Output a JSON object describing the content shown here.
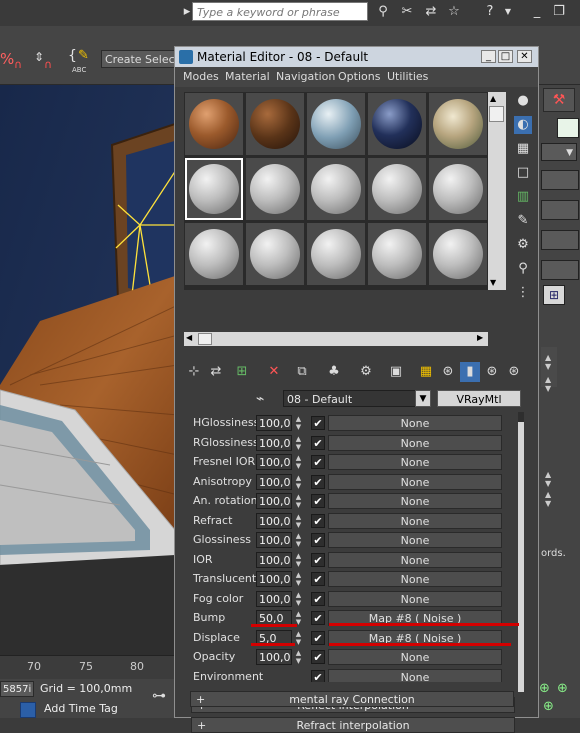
{
  "topbar": {
    "search_placeholder": "Type a keyword or phrase"
  },
  "main_toolbar": {
    "create_selection": "Create Selection Se"
  },
  "ruler": {
    "ticks": [
      "70",
      "75",
      "80"
    ]
  },
  "status": {
    "coord_value": "5857i",
    "grid_label": "Grid = 100,0mm",
    "add_time_tag": "Add Time Tag"
  },
  "right_panel": {
    "truncated_text": "ords."
  },
  "material_editor": {
    "title": "Material Editor - 08 - Default",
    "menu": [
      "Modes",
      "Material",
      "Navigation",
      "Options",
      "Utilities"
    ],
    "material_name": "08 - Default",
    "material_type": "VRayMtl",
    "params": [
      {
        "label": "HGlossiness",
        "value": "100,0",
        "checked": true,
        "map": "None"
      },
      {
        "label": "RGlossiness",
        "value": "100,0",
        "checked": true,
        "map": "None"
      },
      {
        "label": "Fresnel IOR",
        "value": "100,0",
        "checked": true,
        "map": "None"
      },
      {
        "label": "Anisotropy",
        "value": "100,0",
        "checked": true,
        "map": "None"
      },
      {
        "label": "An. rotation",
        "value": "100,0",
        "checked": true,
        "map": "None"
      },
      {
        "label": "Refract",
        "value": "100,0",
        "checked": true,
        "map": "None"
      },
      {
        "label": "Glossiness",
        "value": "100,0",
        "checked": true,
        "map": "None"
      },
      {
        "label": "IOR",
        "value": "100,0",
        "checked": true,
        "map": "None"
      },
      {
        "label": "Translucent",
        "value": "100,0",
        "checked": true,
        "map": "None"
      },
      {
        "label": "Fog color",
        "value": "100,0",
        "checked": true,
        "map": "None"
      },
      {
        "label": "Bump",
        "value": "50,0",
        "checked": true,
        "map": "Map #8  ( Noise )"
      },
      {
        "label": "Displace",
        "value": "5,0",
        "checked": true,
        "map": "Map #8  ( Noise )"
      },
      {
        "label": "Opacity",
        "value": "100,0",
        "checked": true,
        "map": "None"
      },
      {
        "label": "Environment",
        "value": "",
        "checked": true,
        "map": "None"
      }
    ],
    "rollouts": [
      "Reflect interpolation",
      "Refract interpolation",
      "mental ray Connection"
    ],
    "slot_colors": {
      "wood_light": "#9b5a2c",
      "wood_dark": "#5a3418",
      "marble": "#7f9fb4",
      "navy": "#22305a",
      "landscape": "#b7a57f",
      "default_gray": "#bdbdbd"
    },
    "annotation_color": "#d40000"
  }
}
